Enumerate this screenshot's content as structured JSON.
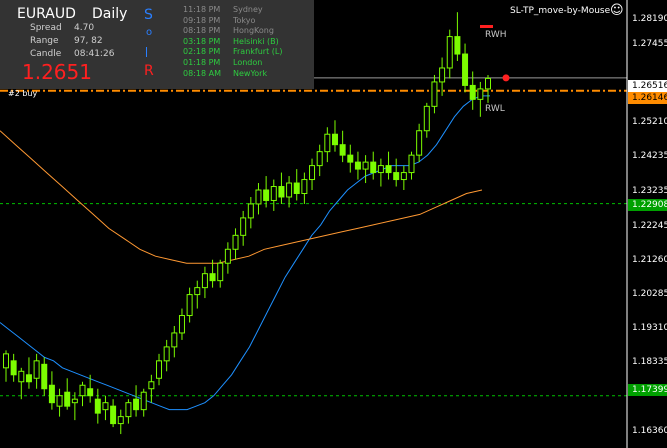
{
  "symbol": "EURAUD",
  "timeframe": "Daily",
  "spread_label": "Spread",
  "spread_value": "4.70",
  "range_label": "Range",
  "range_value": "97, 82",
  "candle_label": "Candle",
  "candle_value": "08:41:26",
  "bid": "1.2651",
  "sor_letters": [
    "S",
    "o",
    "R"
  ],
  "sessions": [
    {
      "time": "11:18 PM",
      "name": "Sydney",
      "active": false
    },
    {
      "time": "09:18 PM",
      "name": "Tokyo",
      "active": false
    },
    {
      "time": "08:18 PM",
      "name": "HongKong",
      "active": false
    },
    {
      "time": "03:18 PM",
      "name": "Helsinki  (B)",
      "active": true
    },
    {
      "time": "02:18 PM",
      "name": "Frankfurt  (L)",
      "active": true
    },
    {
      "time": "01:18 PM",
      "name": "London",
      "active": true
    },
    {
      "time": "08:18 AM",
      "name": "NewYork",
      "active": true
    }
  ],
  "ea_name": "SL-TP_move-by-Mouse",
  "smiley": "☺",
  "order_label": "#2     buy",
  "rwh_label": "RWH",
  "rwl_label": "RWL",
  "axis_prices": [
    "1.28190",
    "1.27455",
    "1.26516",
    "1.26146",
    "1.25210",
    "1.24235",
    "1.23235",
    "1.22908",
    "1.22245",
    "1.21260",
    "1.20285",
    "1.19310",
    "1.18335",
    "1.17399",
    "1.16360"
  ],
  "price_tags": {
    "bid_line": "1.26516",
    "order_line": "1.26146",
    "tp_line": "1.22908",
    "sl_line": "1.17399"
  },
  "colors": {
    "panel_bg": "#333333",
    "bid_red": "#ff2020",
    "session_inactive": "#8a8a8a",
    "session_active": "#2ecc40",
    "order_orange": "#ff8c00",
    "stop_green": "#00c000",
    "candle_green": "#7CFC00",
    "ma_fast": "#1e90ff",
    "ma_slow": "#ff9933",
    "sor_blue": "#2a7fff"
  },
  "chart_data": {
    "type": "candlestick",
    "y_range": [
      1.159,
      1.2875
    ],
    "fast_ma": [
      1.195,
      1.193,
      1.191,
      1.189,
      1.187,
      1.185,
      1.184,
      1.182,
      1.181,
      1.18,
      1.179,
      1.178,
      1.177,
      1.176,
      1.175,
      1.174,
      1.173,
      1.172,
      1.171,
      1.17,
      1.17,
      1.17,
      1.171,
      1.172,
      1.174,
      1.177,
      1.18,
      1.184,
      1.188,
      1.193,
      1.198,
      1.203,
      1.208,
      1.212,
      1.216,
      1.22,
      1.223,
      1.227,
      1.23,
      1.233,
      1.235,
      1.237,
      1.238,
      1.239,
      1.24,
      1.24,
      1.24,
      1.241,
      1.243,
      1.246,
      1.25,
      1.254,
      1.257,
      1.259,
      1.26,
      1.26
    ],
    "slow_ma": [
      1.25,
      1.246,
      1.242,
      1.238,
      1.234,
      1.23,
      1.226,
      1.222,
      1.219,
      1.216,
      1.214,
      1.213,
      1.212,
      1.212,
      1.212,
      1.213,
      1.214,
      1.216,
      1.217,
      1.218,
      1.219,
      1.22,
      1.221,
      1.222,
      1.223,
      1.224,
      1.225,
      1.226,
      1.228,
      1.23,
      1.232,
      1.233
    ],
    "candles": [
      [
        1.182,
        1.187,
        1.178,
        1.186
      ],
      [
        1.184,
        1.186,
        1.178,
        1.18
      ],
      [
        1.178,
        1.182,
        1.173,
        1.181
      ],
      [
        1.18,
        1.185,
        1.176,
        1.178
      ],
      [
        1.179,
        1.186,
        1.176,
        1.184
      ],
      [
        1.183,
        1.185,
        1.174,
        1.176
      ],
      [
        1.177,
        1.181,
        1.17,
        1.172
      ],
      [
        1.171,
        1.176,
        1.168,
        1.174
      ],
      [
        1.175,
        1.179,
        1.17,
        1.171
      ],
      [
        1.172,
        1.175,
        1.167,
        1.173
      ],
      [
        1.174,
        1.178,
        1.171,
        1.177
      ],
      [
        1.176,
        1.18,
        1.172,
        1.174
      ],
      [
        1.173,
        1.176,
        1.166,
        1.169
      ],
      [
        1.17,
        1.174,
        1.167,
        1.172
      ],
      [
        1.171,
        1.173,
        1.165,
        1.166
      ],
      [
        1.166,
        1.17,
        1.163,
        1.168
      ],
      [
        1.168,
        1.173,
        1.166,
        1.172
      ],
      [
        1.173,
        1.177,
        1.168,
        1.17
      ],
      [
        1.17,
        1.176,
        1.168,
        1.175
      ],
      [
        1.176,
        1.18,
        1.172,
        1.178
      ],
      [
        1.179,
        1.186,
        1.177,
        1.184
      ],
      [
        1.184,
        1.19,
        1.181,
        1.188
      ],
      [
        1.188,
        1.194,
        1.185,
        1.192
      ],
      [
        1.192,
        1.199,
        1.19,
        1.197
      ],
      [
        1.197,
        1.205,
        1.195,
        1.203
      ],
      [
        1.203,
        1.207,
        1.199,
        1.205
      ],
      [
        1.205,
        1.211,
        1.202,
        1.209
      ],
      [
        1.209,
        1.213,
        1.205,
        1.207
      ],
      [
        1.207,
        1.213,
        1.205,
        1.212
      ],
      [
        1.212,
        1.218,
        1.209,
        1.216
      ],
      [
        1.216,
        1.222,
        1.213,
        1.22
      ],
      [
        1.22,
        1.227,
        1.217,
        1.225
      ],
      [
        1.225,
        1.231,
        1.222,
        1.229
      ],
      [
        1.229,
        1.235,
        1.226,
        1.233
      ],
      [
        1.233,
        1.237,
        1.228,
        1.23
      ],
      [
        1.23,
        1.236,
        1.227,
        1.234
      ],
      [
        1.234,
        1.238,
        1.229,
        1.231
      ],
      [
        1.231,
        1.237,
        1.228,
        1.235
      ],
      [
        1.235,
        1.239,
        1.23,
        1.232
      ],
      [
        1.232,
        1.238,
        1.229,
        1.236
      ],
      [
        1.236,
        1.242,
        1.233,
        1.24
      ],
      [
        1.24,
        1.246,
        1.237,
        1.244
      ],
      [
        1.244,
        1.251,
        1.241,
        1.249
      ],
      [
        1.249,
        1.253,
        1.244,
        1.246
      ],
      [
        1.246,
        1.25,
        1.241,
        1.243
      ],
      [
        1.243,
        1.246,
        1.238,
        1.241
      ],
      [
        1.241,
        1.244,
        1.236,
        1.239
      ],
      [
        1.239,
        1.243,
        1.235,
        1.241
      ],
      [
        1.241,
        1.244,
        1.236,
        1.238
      ],
      [
        1.238,
        1.242,
        1.234,
        1.24
      ],
      [
        1.24,
        1.244,
        1.236,
        1.238
      ],
      [
        1.238,
        1.242,
        1.234,
        1.236
      ],
      [
        1.236,
        1.24,
        1.233,
        1.238
      ],
      [
        1.238,
        1.244,
        1.236,
        1.243
      ],
      [
        1.243,
        1.252,
        1.241,
        1.25
      ],
      [
        1.25,
        1.258,
        1.248,
        1.257
      ],
      [
        1.257,
        1.266,
        1.255,
        1.264
      ],
      [
        1.264,
        1.271,
        1.26,
        1.268
      ],
      [
        1.268,
        1.279,
        1.265,
        1.277
      ],
      [
        1.277,
        1.284,
        1.27,
        1.272
      ],
      [
        1.272,
        1.275,
        1.261,
        1.263
      ],
      [
        1.263,
        1.267,
        1.256,
        1.259
      ],
      [
        1.259,
        1.264,
        1.254,
        1.262
      ],
      [
        1.262,
        1.266,
        1.258,
        1.265
      ]
    ]
  }
}
